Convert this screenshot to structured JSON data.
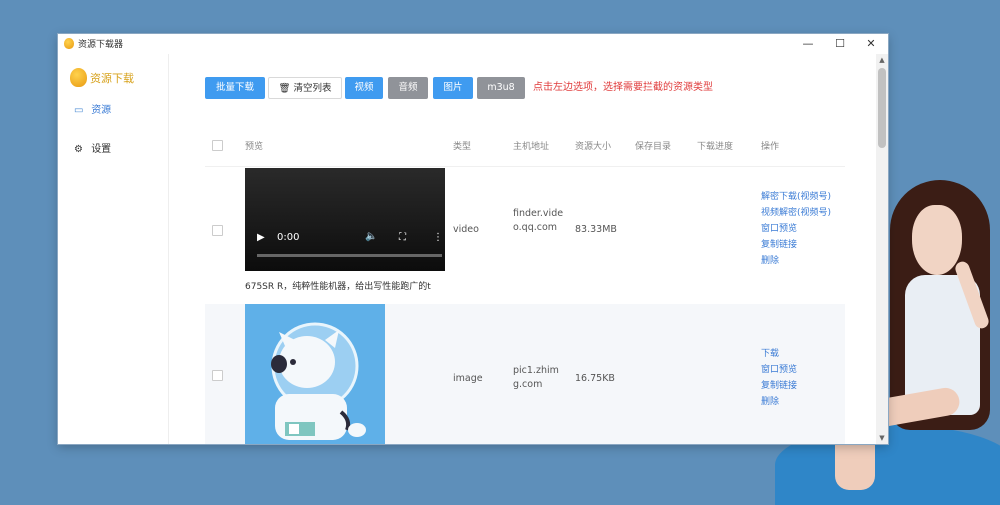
{
  "window": {
    "title": "资源下载器"
  },
  "sidebar": {
    "brand": "资源下载",
    "items": [
      {
        "label": "资源",
        "icon": "monitor-icon"
      },
      {
        "label": "设置",
        "icon": "gear-icon"
      }
    ]
  },
  "toolbar": {
    "batch_download": "批量下载",
    "clear_list": "清空列表",
    "filters": [
      "视频",
      "音频",
      "图片",
      "m3u8"
    ],
    "hint": "点击左边选项，选择需要拦截的资源类型"
  },
  "table": {
    "columns": [
      "预览",
      "类型",
      "主机地址",
      "资源大小",
      "保存目录",
      "下载进度",
      "操作"
    ],
    "rows": [
      {
        "preview_kind": "video",
        "video_time": "0:00",
        "caption": "675SR R，纯粹性能机器，给出写性能跑广的t",
        "type": "video",
        "host": "finder.video.qq.com",
        "size": "83.33MB",
        "ops": [
          "解密下载(视频号)",
          "视频解密(视频号)",
          "窗口预览",
          "复制链接",
          "删除"
        ]
      },
      {
        "preview_kind": "image",
        "type": "image",
        "host": "pic1.zhimg.com",
        "size": "16.75KB",
        "ops": [
          "下载",
          "窗口预览",
          "复制链接",
          "删除"
        ]
      }
    ]
  }
}
